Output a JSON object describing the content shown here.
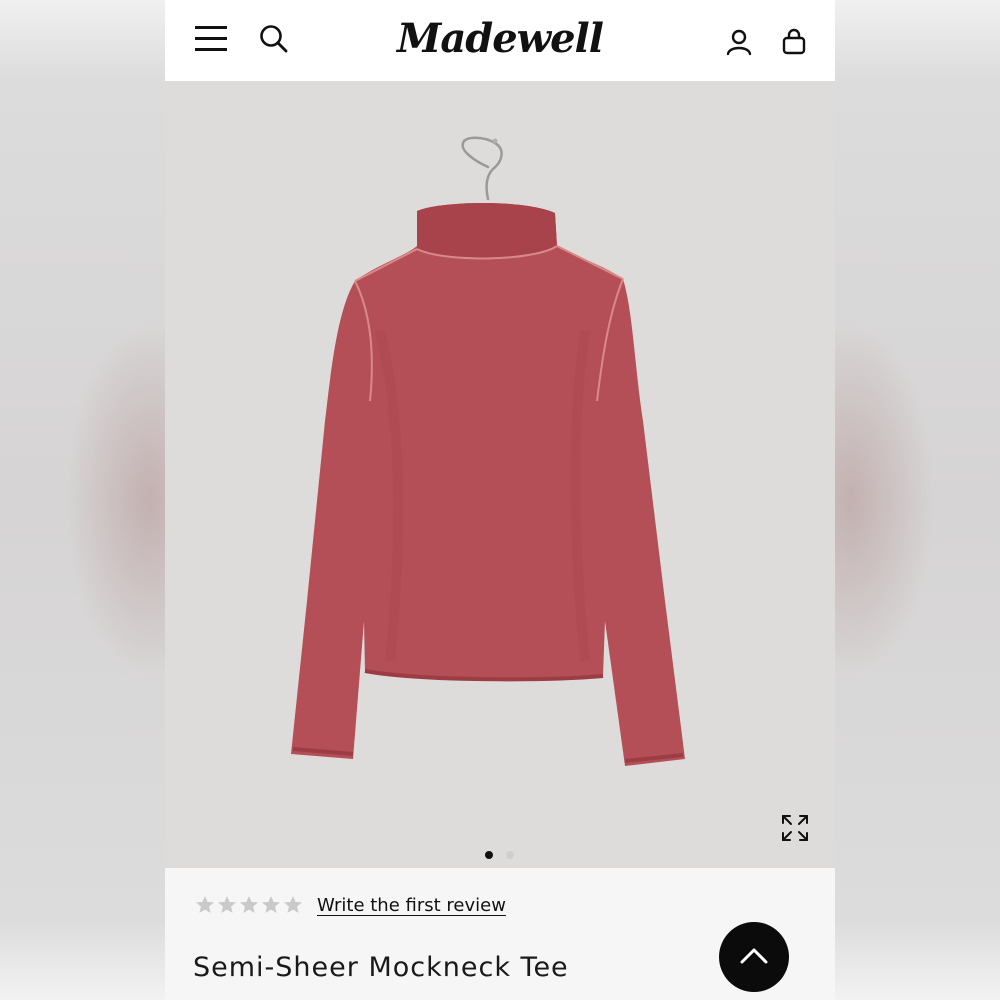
{
  "header": {
    "logo_text": "Madewell",
    "menu_icon": "hamburger-menu-icon",
    "search_icon": "magnifier-search-icon",
    "account_icon": "person-account-icon",
    "bag_icon": "shopping-bag-icon"
  },
  "gallery": {
    "image_subject": "Red semi-sheer long-sleeve mockneck tee on a hanger",
    "image_count": 2,
    "active_index": 1,
    "expand_icon": "expand-arrows-icon"
  },
  "product": {
    "rating_stars": 5,
    "rating_filled": 0,
    "review_link": "Write the first review",
    "title": "Semi-Sheer Mockneck Tee"
  },
  "scroll_top": {
    "icon": "chevron-up-icon"
  },
  "colors": {
    "header_bg": "#ffffff",
    "hero_bg": "#dddcdb",
    "garment": "#b44f57",
    "info_bg": "#f6f6f6",
    "star_empty": "#c9c9c9",
    "button_bg": "#0b0b0b"
  }
}
